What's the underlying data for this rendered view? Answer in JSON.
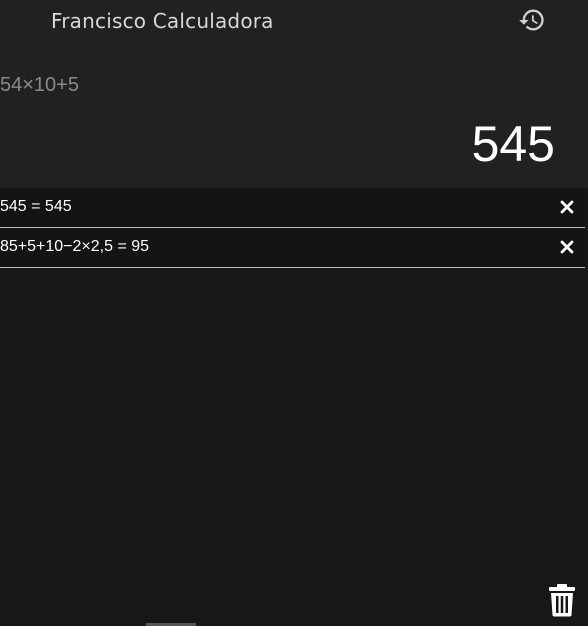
{
  "app": {
    "title": "Francisco Calculadora"
  },
  "display": {
    "expression": "54×10+5",
    "result": "545"
  },
  "history": {
    "items": [
      {
        "text": "545 = 545"
      },
      {
        "text": "85+5+10−2×2,5 = 95"
      }
    ]
  },
  "icons": {
    "history": "history-icon",
    "close": "close-icon",
    "trash": "trash-icon"
  },
  "colors": {
    "header_bg": "#212121",
    "list_bg": "#171717",
    "text_primary": "#ffffff",
    "text_muted": "#8a8a8a",
    "title_text": "#d8d8d8"
  }
}
